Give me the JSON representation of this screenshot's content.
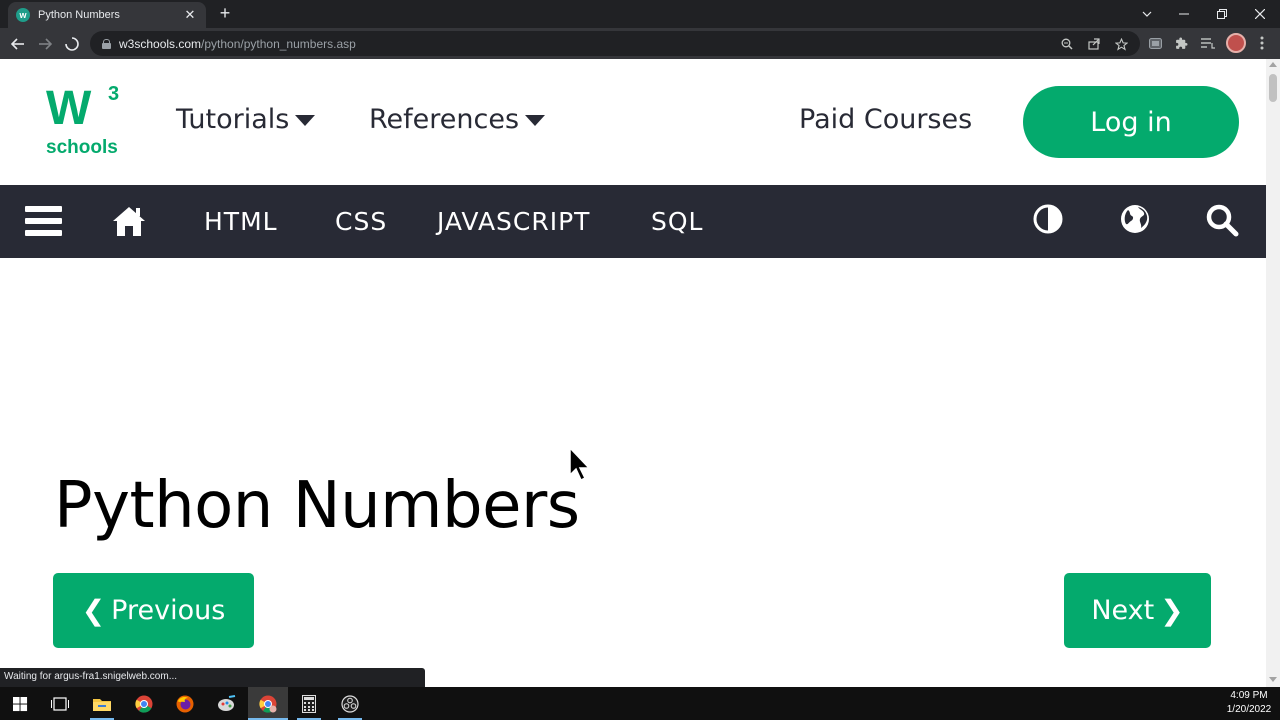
{
  "browser": {
    "tab_title": "Python Numbers",
    "tab_close": "✕",
    "new_tab": "+",
    "url_host": "w3schools.com",
    "url_path": "/python/python_numbers.asp",
    "status_text": "Waiting for argus-fra1.snigelweb.com..."
  },
  "site": {
    "logo_w": "W",
    "logo_three": "3",
    "logo_schools": "schools",
    "brand_color": "#04aa6d",
    "dark_bar_color": "#282a35",
    "menu": {
      "tutorials": "Tutorials",
      "references": "References",
      "paid_courses": "Paid Courses",
      "login": "Log in"
    },
    "subnav": {
      "html": "HTML",
      "css": "CSS",
      "javascript": "JAVASCRIPT",
      "sql": "SQL"
    }
  },
  "content": {
    "title": "Python Numbers",
    "previous_chevron": "❮",
    "previous_label": "Previous",
    "next_label": "Next",
    "next_chevron": "❯"
  },
  "taskbar": {
    "time": "4:09 PM",
    "date": "1/20/2022"
  },
  "icons": {
    "back": "arrow-left-icon",
    "forward": "arrow-right-icon",
    "reload": "loading-icon",
    "zoom": "zoom-icon",
    "share": "share-icon",
    "bookmark": "star-icon",
    "extensions": "puzzle-icon",
    "menu": "kebab-menu-icon"
  }
}
